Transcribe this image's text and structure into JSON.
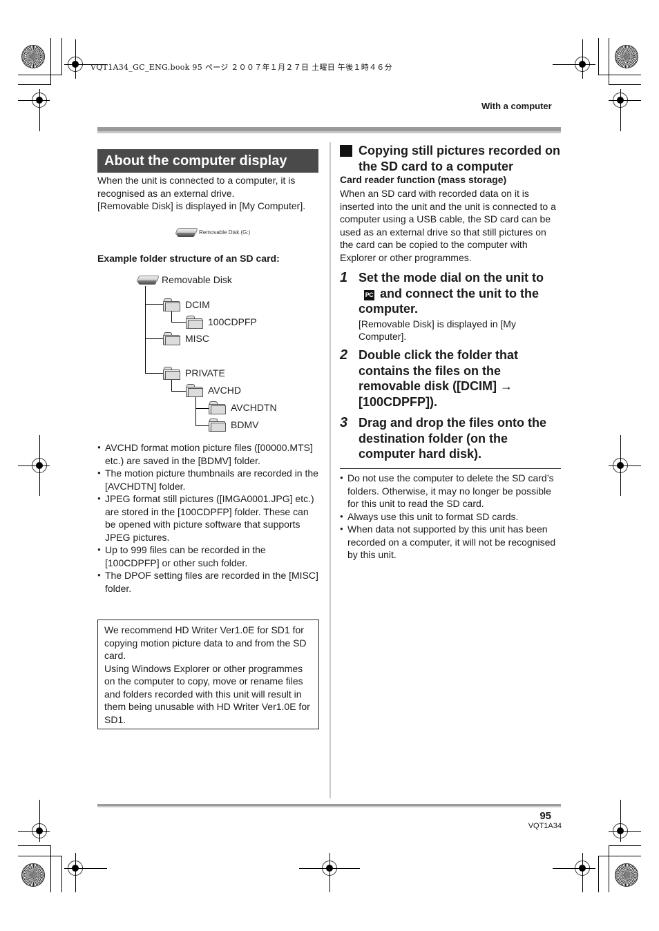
{
  "print_meta": {
    "slug": "VQT1A34_GC_ENG.book  95 ページ  ２００７年１月２７日  土曜日  午後１時４６分"
  },
  "header": {
    "section": "With a computer"
  },
  "left": {
    "banner": "About the computer display",
    "intro": [
      "When the unit is connected to a computer, it is recognised as an external drive.",
      "[Removable Disk] is displayed in [My Computer]."
    ],
    "drive_icon": {
      "icon": "removable-disk-icon",
      "label": "Removable Disk (G:)"
    },
    "example_title": "Example folder structure of an SD card:",
    "tree": {
      "root": "Removable Disk",
      "nodes": [
        {
          "name": "DCIM",
          "level": 1
        },
        {
          "name": "100CDPFP",
          "level": 2
        },
        {
          "name": "MISC",
          "level": 1
        },
        {
          "name": "PRIVATE",
          "level": 1
        },
        {
          "name": "AVCHD",
          "level": 2
        },
        {
          "name": "AVCHDTN",
          "level": 3
        },
        {
          "name": "BDMV",
          "level": 3
        }
      ]
    },
    "bullets": [
      "AVCHD format motion picture files ([00000.MTS] etc.) are saved in the [BDMV] folder.",
      "The motion picture thumbnails are recorded in the [AVCHDTN] folder.",
      "JPEG format still pictures ([IMGA0001.JPG] etc.) are stored in the [100CDPFP] folder. These can be opened with picture software that supports JPEG pictures.",
      "Up to 999 files can be recorded in the [100CDPFP] or other such folder.",
      "The DPOF setting files are recorded in the [MISC] folder."
    ],
    "box_note": [
      "We recommend HD Writer Ver1.0E for SD1 for copying motion picture data to and from the SD card.",
      "Using Windows Explorer or other programmes on the computer to copy, move or rename files and folders recorded with this unit will result in them being unusable with HD Writer Ver1.0E for SD1."
    ]
  },
  "right": {
    "heading": "Copying still pictures recorded on the SD card to a computer",
    "subheading": "Card reader function (mass storage)",
    "intro": "When an SD card with recorded data on it is inserted into the unit and the unit is connected to a computer using a USB cable, the SD card can be used as an external drive so that still pictures on the card can be copied to the computer with Explorer or other programmes.",
    "steps": [
      {
        "number": "1",
        "title_pre": "Set the mode dial on the unit to",
        "icon": "PC",
        "title_post": "and connect the unit to the computer.",
        "desc": "[Removable Disk] is displayed in [My Computer]."
      },
      {
        "number": "2",
        "title": "Double click the folder that contains the files on the removable disk ([DCIM] → [100CDPFP])."
      },
      {
        "number": "3",
        "title": "Drag and drop the files onto the destination folder (on the computer hard disk)."
      }
    ],
    "notes": [
      "Do not use the computer to delete the SD card’s folders. Otherwise, it may no longer be possible for this unit to read the SD card.",
      "Always use this unit to format SD cards.",
      "When data not supported by this unit has been recorded on a computer, it will not be recognised by this unit."
    ]
  },
  "footer": {
    "page_number": "95",
    "model_code": "VQT1A34"
  }
}
